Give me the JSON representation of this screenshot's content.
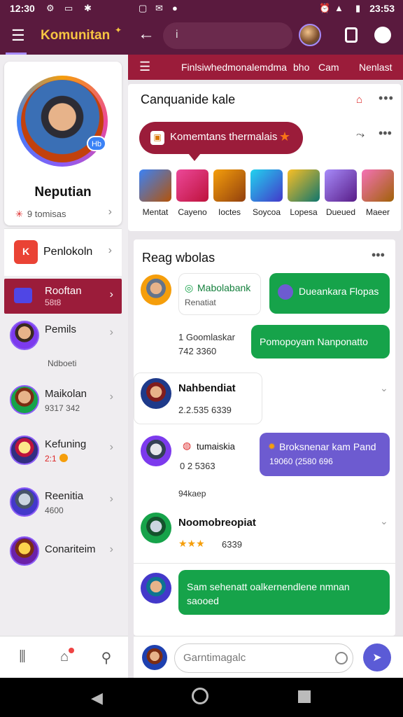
{
  "status": {
    "time_left": "12:30",
    "time_right": "23:53"
  },
  "topbar": {
    "title": "Komunitan",
    "search_placeholder": "i"
  },
  "sidebar": {
    "profile_name": "Neputian",
    "profile_sub": "9 tomisas",
    "pen_label": "Penlokoln",
    "pen_icon_text": "K",
    "items": [
      {
        "label": "Rooftan",
        "sub": "58t8",
        "active": true
      },
      {
        "label": "Pemils",
        "sub": ""
      },
      {
        "label": "Maikolan",
        "sub": "9317 342"
      },
      {
        "label": "Kefuning",
        "sub": "2:1"
      },
      {
        "label": "Reenitia",
        "sub": "4600"
      },
      {
        "label": "Conariteim",
        "sub": ""
      }
    ],
    "gap_text": "Ndboeti"
  },
  "tabbar": {
    "tabs": [
      "Finlsiwhedmonalemdma",
      "bho",
      "Cam",
      "Nenlast"
    ]
  },
  "community": {
    "title": "Canquanide kale",
    "bubble_text": "Komemtans thermalais",
    "heroes": [
      {
        "name": "Mentat",
        "color": "#b45309"
      },
      {
        "name": "Cayeno",
        "color": "#be123c"
      },
      {
        "name": "Ioctes",
        "color": "#92400e"
      },
      {
        "name": "Soycoa",
        "color": "#4338ca"
      },
      {
        "name": "Lopesa",
        "color": "#0f766e"
      },
      {
        "name": "Dueued",
        "color": "#7c3aed"
      },
      {
        "name": "Maeer",
        "color": "#a16207"
      }
    ]
  },
  "chat": {
    "title": "Reag wbolas",
    "messages": {
      "m1_card_title": "Mabolabank",
      "m1_card_sub": "Renatiat",
      "m1_green": "Dueankara Flopas",
      "m2_line1": "1 Goomlaskar",
      "m2_line2": "742 3360",
      "m2_green": "Pomopoyam Nanponatto",
      "m3_name": "Nahbendiat",
      "m3_sub": "2.2.535 6339",
      "m4_name": "tumaiskia",
      "m4_sub": "0 2 5363",
      "m4_purple_1": "Broksnenar kam Pand",
      "m4_purple_2": "19060 (2580 696",
      "m5_meta": "94kaep",
      "m6_name": "Noomobreopiat",
      "m6_sub": "6339",
      "m6_stars": "★★★",
      "m7_green_1": "Sam sehenatt oalkernendlene nmnan",
      "m7_green_2": "saooed"
    }
  },
  "inputbar": {
    "placeholder": "Garntimagalc"
  },
  "colors": {
    "primary": "#5a1a3e",
    "accent": "#9b1c3a",
    "green": "#16a34a",
    "purple": "#6d5bd0"
  }
}
